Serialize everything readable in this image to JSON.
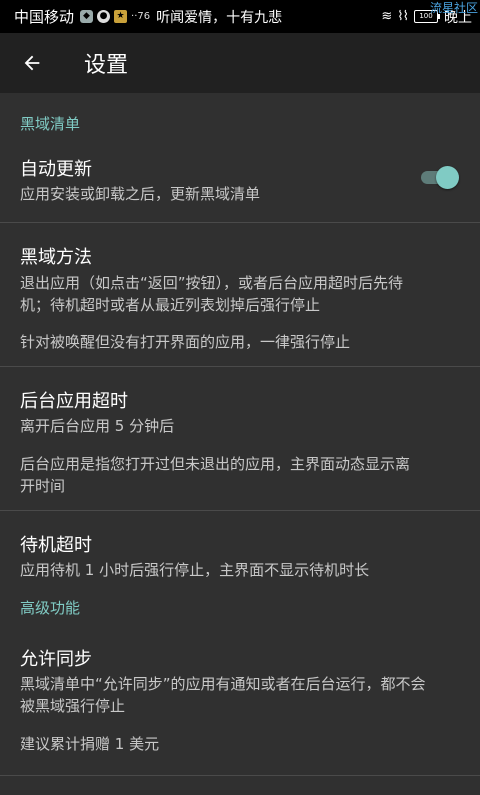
{
  "statusbar": {
    "carrier": "中国移动",
    "small_text": "··76",
    "news": "听闻爱情，十有九悲",
    "battery": "100",
    "time": "晚上",
    "watermark": "流星社区"
  },
  "toolbar": {
    "title": "设置"
  },
  "sections": {
    "blacklist_header": "黑域清单",
    "advanced_header": "高级功能"
  },
  "items": {
    "auto_update": {
      "title": "自动更新",
      "summary": "应用安装或卸载之后，更新黑域清单",
      "enabled": true
    },
    "method": {
      "title": "黑域方法",
      "summary_line1": "退出应用（如点击“返回”按钮），或者后台应用超时后先待",
      "summary_line2": "机；待机超时或者从最近列表划掉后强行停止",
      "note": "针对被唤醒但没有打开界面的应用，一律强行停止"
    },
    "bg_timeout": {
      "title": "后台应用超时",
      "summary": "离开后台应用 5 分钟后",
      "note_line1": "后台应用是指您打开过但未退出的应用，主界面动态显示离",
      "note_line2": "开时间"
    },
    "standby_timeout": {
      "title": "待机超时",
      "summary": "应用待机 1 小时后强行停止，主界面不显示待机时长"
    },
    "allow_sync": {
      "title": "允许同步",
      "summary_line1": "黑域清单中“允许同步”的应用有通知或者在后台运行，都不会",
      "summary_line2": "被黑域强行停止",
      "note": "建议累计捐赠 1 美元"
    }
  },
  "colors": {
    "accent": "#80cbc4",
    "toolbar": "#212121",
    "background": "#303030"
  }
}
